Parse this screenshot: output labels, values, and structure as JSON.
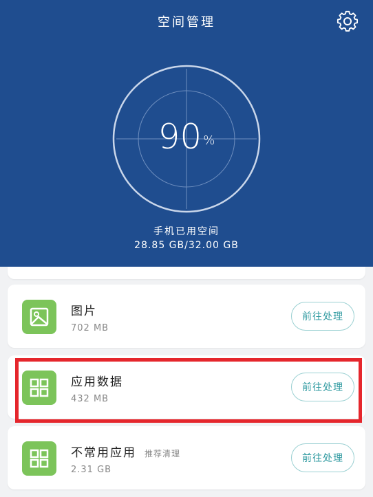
{
  "header": {
    "title": "空间管理",
    "settings_icon": "gear-icon"
  },
  "storage": {
    "used_percent": 90,
    "percent_sign": "%",
    "label": "手机已用空间",
    "used_text": "28.85 GB/32.00 GB"
  },
  "items": [
    {
      "name": "图片",
      "tag": "",
      "size": "702 MB",
      "icon": "image-icon",
      "action_label": "前往处理"
    },
    {
      "name": "应用数据",
      "tag": "",
      "size": "432 MB",
      "icon": "grid-icon",
      "action_label": "前往处理"
    },
    {
      "name": "不常用应用",
      "tag": "推荐清理",
      "size": "2.31 GB",
      "icon": "grid-icon",
      "action_label": "前往处理"
    }
  ],
  "colors": {
    "header_bg": "#1f4d8f",
    "icon_green": "#7cc45a",
    "button_text": "#2f9aa0",
    "highlight_red": "#e5262c"
  }
}
